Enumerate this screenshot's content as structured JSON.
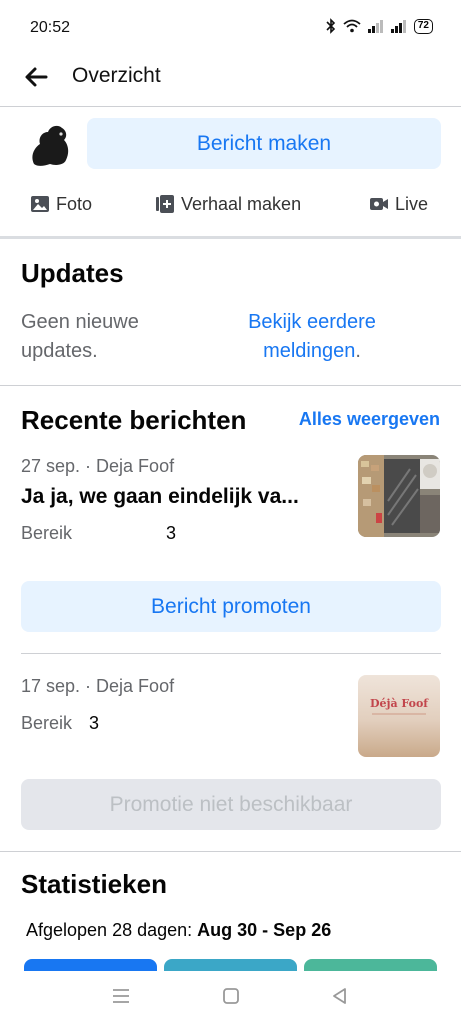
{
  "status_bar": {
    "time": "20:52",
    "battery": "72"
  },
  "header": {
    "title": "Overzicht"
  },
  "composer": {
    "create_post_label": "Bericht maken",
    "actions": [
      {
        "label": "Foto",
        "icon": "photo-icon"
      },
      {
        "label": "Verhaal maken",
        "icon": "story-plus-icon"
      },
      {
        "label": "Live",
        "icon": "live-video-icon"
      }
    ]
  },
  "updates": {
    "title": "Updates",
    "empty_text": "Geen nieuwe updates.",
    "link_text": "Bekijk eerdere meldingen",
    "link_suffix": "."
  },
  "recent_posts": {
    "title": "Recente berichten",
    "see_all_label": "Alles weergeven",
    "posts": [
      {
        "meta": "27 sep. · Deja Foof",
        "title": "Ja ja, we gaan eindelijk va...",
        "reach_label": "Bereik",
        "reach_value": "3",
        "promote_label": "Bericht promoten",
        "promote_enabled": true
      },
      {
        "meta": "17 sep. · Deja Foof",
        "title": "",
        "reach_label": "Bereik",
        "reach_value": "3",
        "thumb_text": "Déjà Foof",
        "promote_label": "Promotie niet beschikbaar",
        "promote_enabled": false
      }
    ]
  },
  "statistics": {
    "title": "Statistieken",
    "range_label": "Afgelopen 28 dagen:",
    "range_value": "Aug 30 - Sep 26"
  },
  "colors": {
    "accent": "#1877f2",
    "accent_bg": "#e7f3ff",
    "muted_text": "#65676b",
    "tab_blue": "#1877f2",
    "tab_teal": "#3ba7c7",
    "tab_green": "#4cb79a"
  }
}
